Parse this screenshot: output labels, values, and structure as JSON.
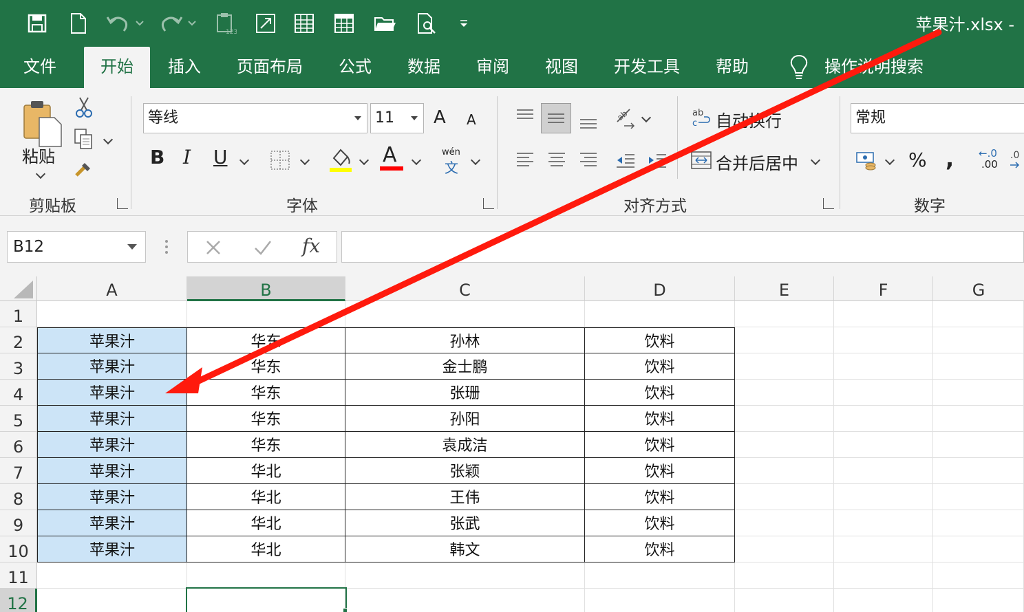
{
  "app": {
    "title": "苹果汁.xlsx  -",
    "accent_color": "#217346"
  },
  "qat": {
    "icons": [
      "save-icon",
      "new-file-icon",
      "undo-icon",
      "redo-icon",
      "paste-values-icon",
      "freeze-icon",
      "table-icon",
      "grid-icon",
      "open-icon",
      "print-preview-icon",
      "customize-icon"
    ]
  },
  "tabs": [
    {
      "label": "文件"
    },
    {
      "label": "开始"
    },
    {
      "label": "插入"
    },
    {
      "label": "页面布局"
    },
    {
      "label": "公式"
    },
    {
      "label": "数据"
    },
    {
      "label": "审阅"
    },
    {
      "label": "视图"
    },
    {
      "label": "开发工具"
    },
    {
      "label": "帮助"
    },
    {
      "label": "操作说明搜索"
    }
  ],
  "ribbon": {
    "clipboard": {
      "label": "剪贴板",
      "paste_label": "粘贴"
    },
    "font": {
      "label": "字体",
      "font_name": "等线",
      "font_size": "11",
      "grow_label": "A",
      "shrink_label": "A",
      "bold_label": "B",
      "italic_label": "I",
      "underline_label": "U",
      "font_color_label": "A",
      "phonetic_top": "wén",
      "phonetic_bottom": "文"
    },
    "alignment": {
      "label": "对齐方式",
      "wrap_label": "自动换行",
      "merge_label": "合并后居中"
    },
    "number": {
      "label": "数字",
      "format": "常规",
      "percent_label": "%",
      "comma_label": ",",
      "inc_decimal_top": "←.0",
      "inc_decimal_bottom": ".00"
    }
  },
  "formula_bar": {
    "name_box": "B12",
    "fx_label": "fx",
    "formula": ""
  },
  "sheet": {
    "columns": [
      "A",
      "B",
      "C",
      "D",
      "E",
      "F",
      "G"
    ],
    "rows": [
      "1",
      "2",
      "3",
      "4",
      "5",
      "6",
      "7",
      "8",
      "9",
      "10",
      "11",
      "12"
    ],
    "data": [
      [
        "苹果汁",
        "华东",
        "孙林",
        "饮料"
      ],
      [
        "苹果汁",
        "华东",
        "金士鹏",
        "饮料"
      ],
      [
        "苹果汁",
        "华东",
        "张珊",
        "饮料"
      ],
      [
        "苹果汁",
        "华东",
        "孙阳",
        "饮料"
      ],
      [
        "苹果汁",
        "华东",
        "袁成洁",
        "饮料"
      ],
      [
        "苹果汁",
        "华北",
        "张颖",
        "饮料"
      ],
      [
        "苹果汁",
        "华北",
        "王伟",
        "饮料"
      ],
      [
        "苹果汁",
        "华北",
        "张武",
        "饮料"
      ],
      [
        "苹果汁",
        "华北",
        "韩文",
        "饮料"
      ]
    ],
    "selected_column": "B",
    "selected_row": "12",
    "highlight_color": "#cce4f7",
    "annotation_arrow_color": "#ff1a0d"
  }
}
